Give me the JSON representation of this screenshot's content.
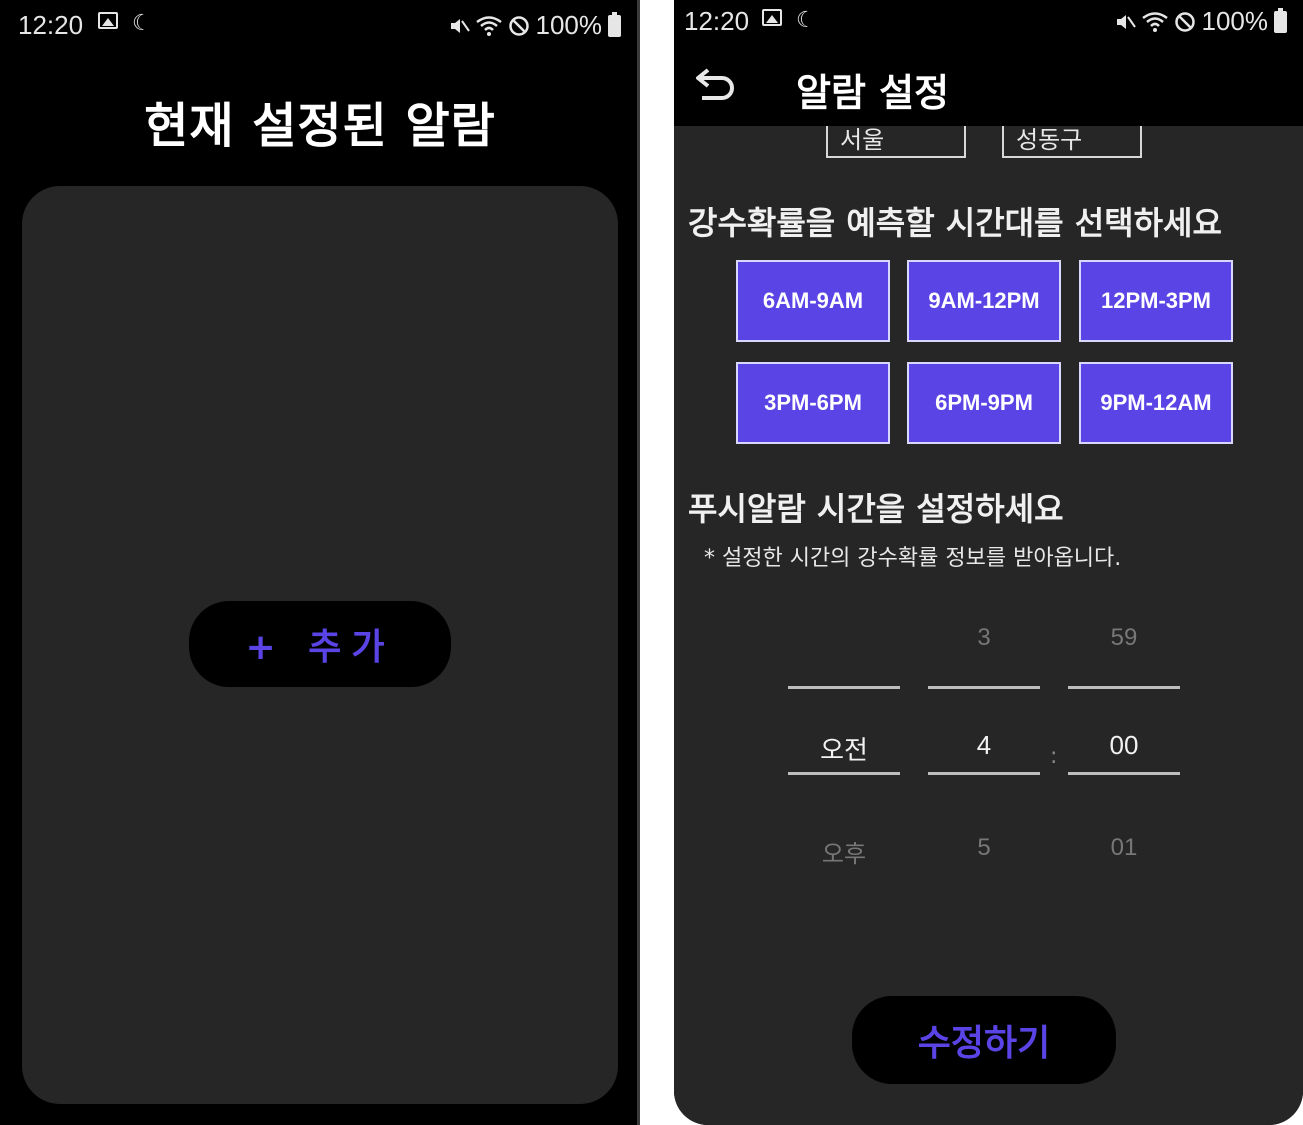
{
  "left_screen": {
    "status_bar": {
      "time": "12:20",
      "battery": "100%"
    },
    "title": "현재 설정된 알람",
    "add_button_label": "+ 추가"
  },
  "right_screen": {
    "status_bar": {
      "time": "12:20",
      "battery": "100%"
    },
    "header_title": "알람 설정",
    "region": {
      "city": "서울",
      "district": "성동구"
    },
    "timeslot_heading": "강수확률을 예측할 시간대를 선택하세요",
    "timeslots": [
      "6AM-9AM",
      "9AM-12PM",
      "12PM-3PM",
      "3PM-6PM",
      "6PM-9PM",
      "9PM-12AM"
    ],
    "push_heading": "푸시알람 시간을 설정하세요",
    "push_note": "* 설정한 시간의 강수확률 정보를 받아옵니다.",
    "time_picker": {
      "ampm": {
        "above": "",
        "selected": "오전",
        "below": "오후"
      },
      "hour": {
        "above": "3",
        "selected": "4",
        "below": "5"
      },
      "separator": ":",
      "minute": {
        "above": "59",
        "selected": "00",
        "below": "01"
      }
    },
    "edit_button_label": "수정하기"
  },
  "colors": {
    "accent": "#5a44e6",
    "panel": "#262627",
    "background": "#000000"
  },
  "icons": [
    "image-icon",
    "moon-icon",
    "mute-icon",
    "wifi-icon",
    "blocked-icon",
    "battery-icon",
    "back-arrow-icon"
  ]
}
